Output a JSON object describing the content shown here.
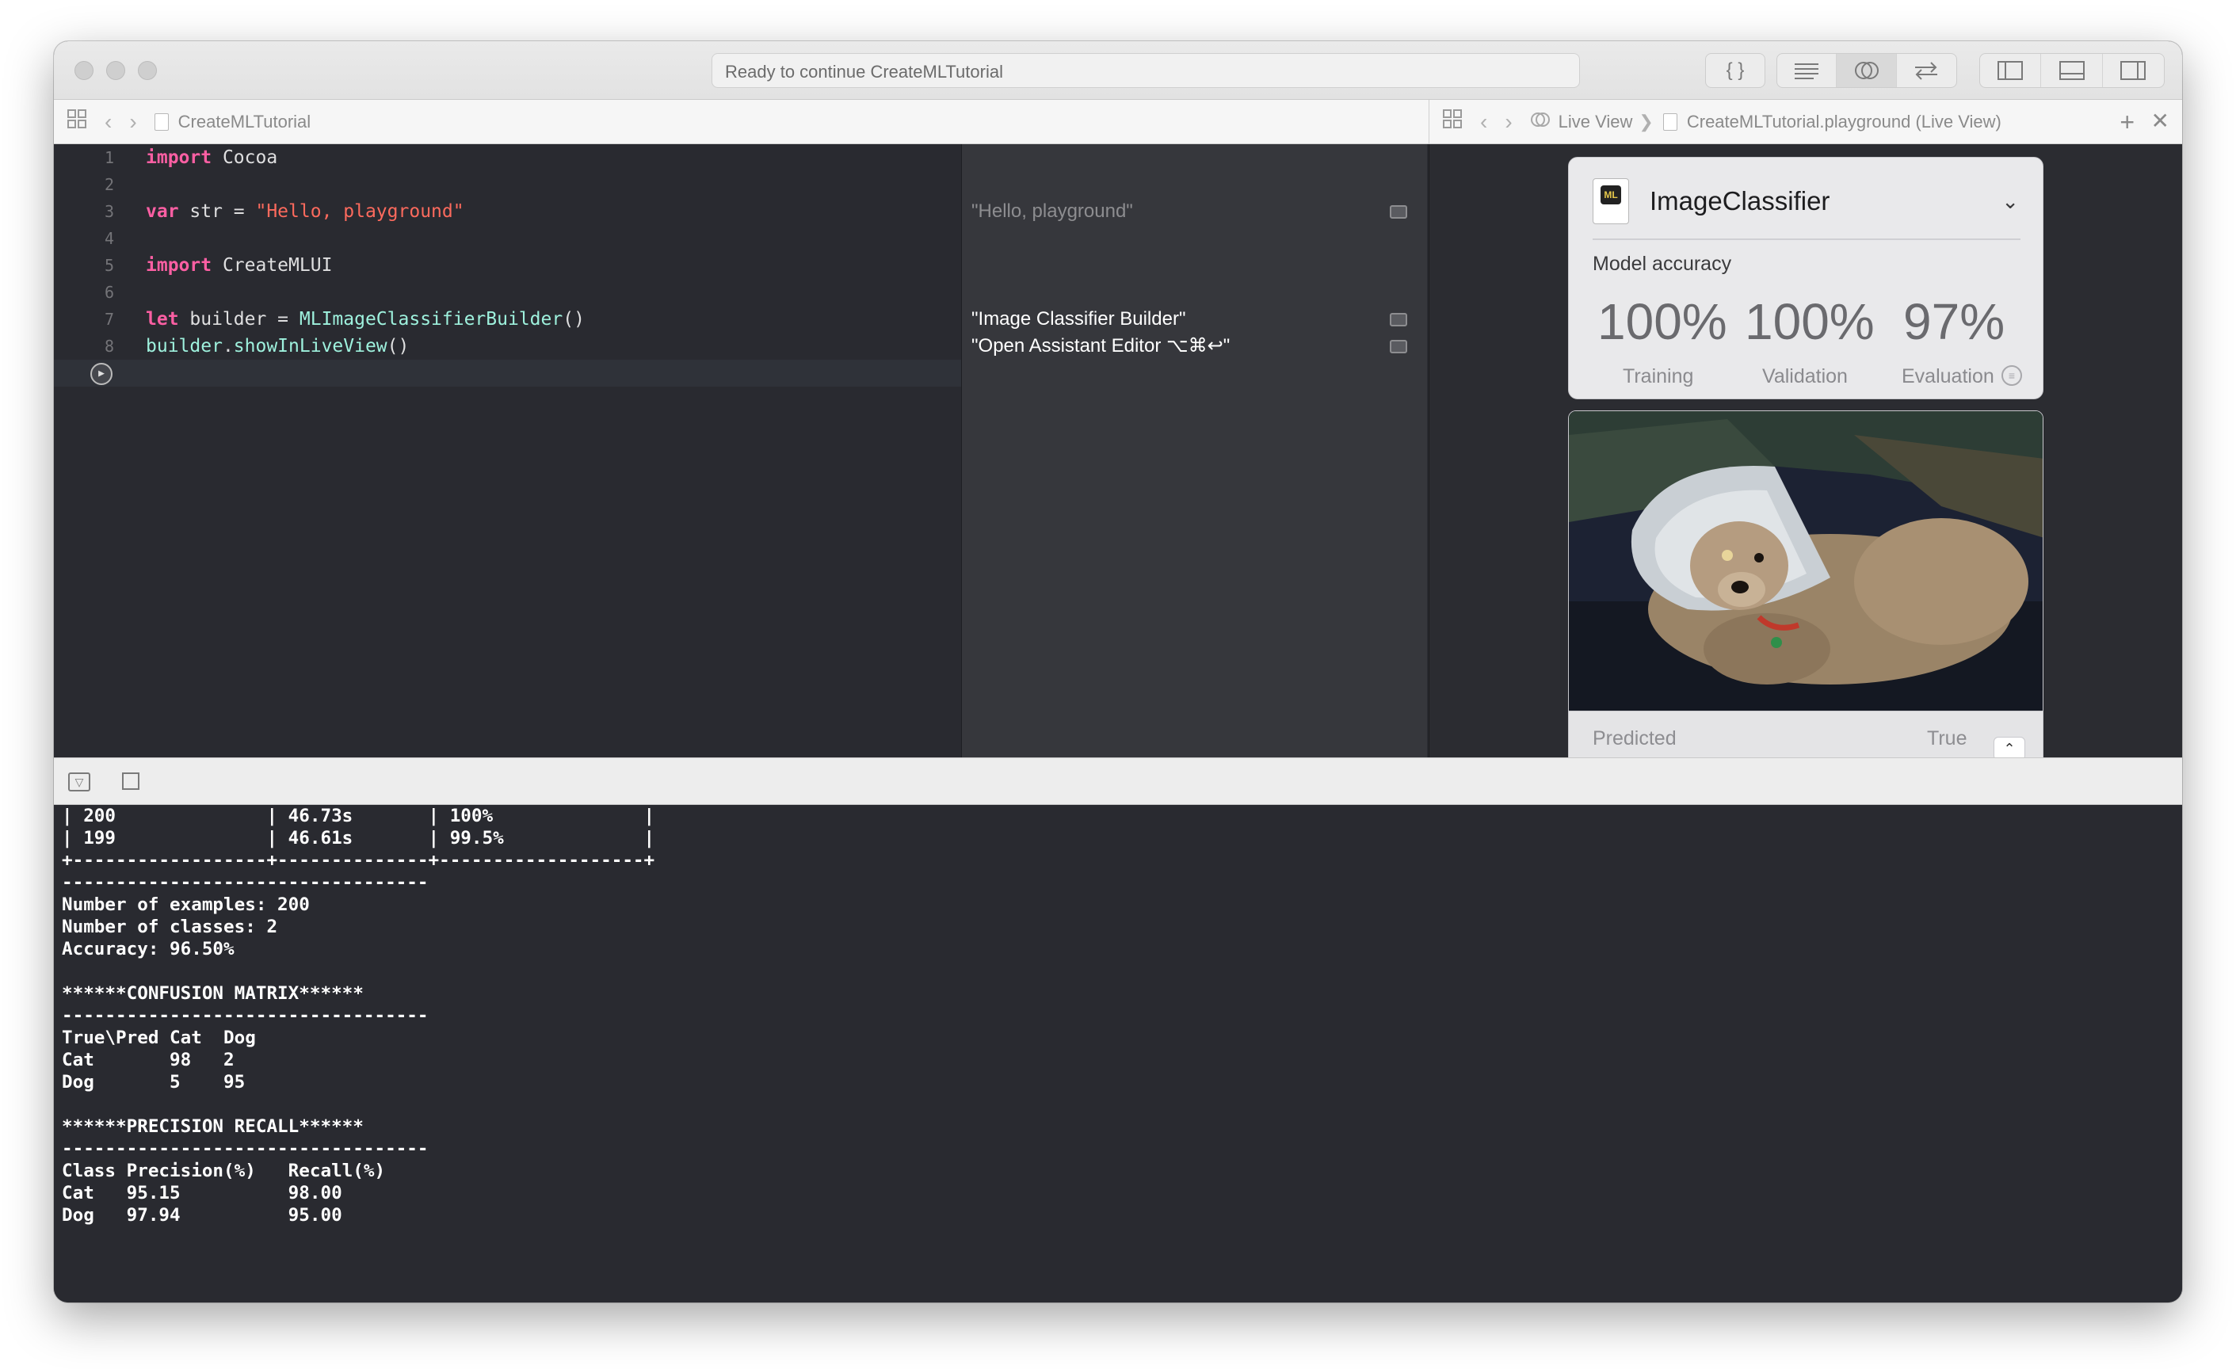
{
  "titlebar": {
    "activity_status": "Ready to continue CreateMLTutorial",
    "toolbar_buttons": [
      "code-snippet-icon",
      "standard-editor-icon",
      "assistant-editor-icon",
      "version-editor-icon",
      "navigator-toggle-icon",
      "debug-area-toggle-icon",
      "utilities-toggle-icon"
    ]
  },
  "editor_jumpbar": {
    "file_name": "CreateMLTutorial"
  },
  "live_jumpbar": {
    "crumb_1": "Live View",
    "crumb_2": "CreateMLTutorial.playground (Live View)"
  },
  "editor": {
    "line_numbers": [
      "1",
      "2",
      "3",
      "4",
      "5",
      "6",
      "7",
      "8"
    ],
    "l1_kw": "import",
    "l1_rest": " Cocoa",
    "l3_kw": "var",
    "l3_mid": " str = ",
    "l3_str": "\"Hello, playground\"",
    "l5_kw": "import",
    "l5_rest": " CreateMLUI",
    "l7_kw": "let",
    "l7_mid": " builder = ",
    "l7_cls": "MLImageClassifierBuilder",
    "l7_end": "()",
    "l8_obj": "builder",
    "l8_dot": ".",
    "l8_fn": "showInLiveView",
    "l8_end": "()"
  },
  "results": {
    "r3": "\"Hello, playground\"",
    "r7": "\"Image Classifier Builder\"",
    "r8": "\"Open Assistant Editor ⌥⌘↩\""
  },
  "live_view": {
    "model_name": "ImageClassifier",
    "model_icon_text": "ML",
    "accuracy_label": "Model accuracy",
    "training_value": "100%",
    "validation_value": "100%",
    "evaluation_value": "97%",
    "training_label": "Training",
    "validation_label": "Validation",
    "evaluation_label": "Evaluation",
    "predicted_label": "Predicted",
    "true_label": "True"
  },
  "console": {
    "text": "| 200              | 46.73s       | 100%              |\n| 199              | 46.61s       | 99.5%             |\n+------------------+--------------+-------------------+\n----------------------------------\nNumber of examples: 200\nNumber of classes: 2\nAccuracy: 96.50%\n\n******CONFUSION MATRIX******\n----------------------------------\nTrue\\Pred Cat  Dog\nCat       98   2\nDog       5    95\n\n******PRECISION RECALL******\n----------------------------------\nClass Precision(%)   Recall(%)\nCat   95.15          98.00\nDog   97.94          95.00"
  }
}
